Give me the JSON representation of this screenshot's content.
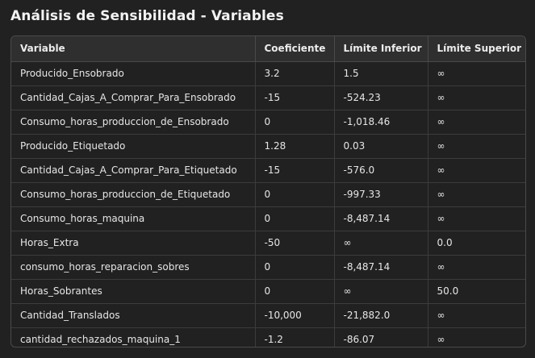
{
  "title": "Análisis de Sensibilidad - Variables",
  "table": {
    "headers": [
      "Variable",
      "Coeficiente",
      "Límite Inferior",
      "Límite Superior"
    ],
    "rows": [
      [
        "Producido_Ensobrado",
        "3.2",
        "1.5",
        "∞"
      ],
      [
        "Cantidad_Cajas_A_Comprar_Para_Ensobrado",
        "-15",
        "-524.23",
        "∞"
      ],
      [
        "Consumo_horas_produccion_de_Ensobrado",
        "0",
        "-1,018.46",
        "∞"
      ],
      [
        "Producido_Etiquetado",
        "1.28",
        "0.03",
        "∞"
      ],
      [
        "Cantidad_Cajas_A_Comprar_Para_Etiquetado",
        "-15",
        "-576.0",
        "∞"
      ],
      [
        "Consumo_horas_produccion_de_Etiquetado",
        "0",
        "-997.33",
        "∞"
      ],
      [
        "Consumo_horas_maquina",
        "0",
        "-8,487.14",
        "∞"
      ],
      [
        "Horas_Extra",
        "-50",
        "∞",
        "0.0"
      ],
      [
        "consumo_horas_reparacion_sobres",
        "0",
        "-8,487.14",
        "∞"
      ],
      [
        "Horas_Sobrantes",
        "0",
        "∞",
        "50.0"
      ],
      [
        "Cantidad_Translados",
        "-10,000",
        "-21,882.0",
        "∞"
      ],
      [
        "cantidad_rechazados_maquina_1",
        "-1.2",
        "-86.07",
        "∞"
      ]
    ]
  }
}
